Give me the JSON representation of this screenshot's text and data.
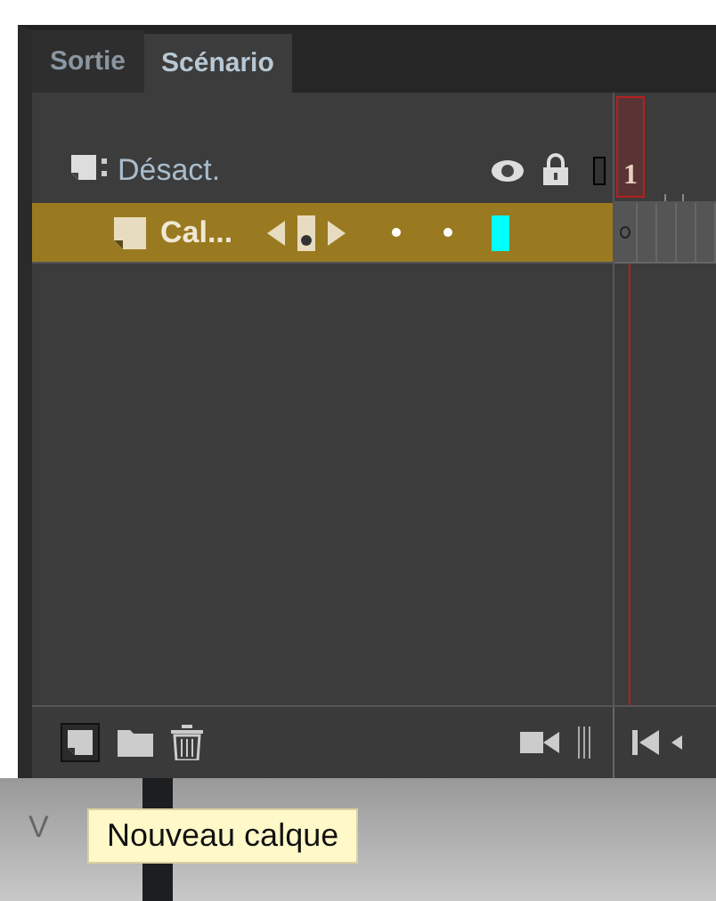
{
  "tabs": [
    {
      "label": "Sortie",
      "selected": false
    },
    {
      "label": "Scénario",
      "selected": true
    }
  ],
  "header": {
    "label": "Désact."
  },
  "layers": [
    {
      "name": "Cal...",
      "selected": true,
      "color": "#00ffff"
    }
  ],
  "ruler": {
    "frame_label": "1"
  },
  "background": {
    "text": "V"
  },
  "tooltip": {
    "text": "Nouveau calque"
  }
}
